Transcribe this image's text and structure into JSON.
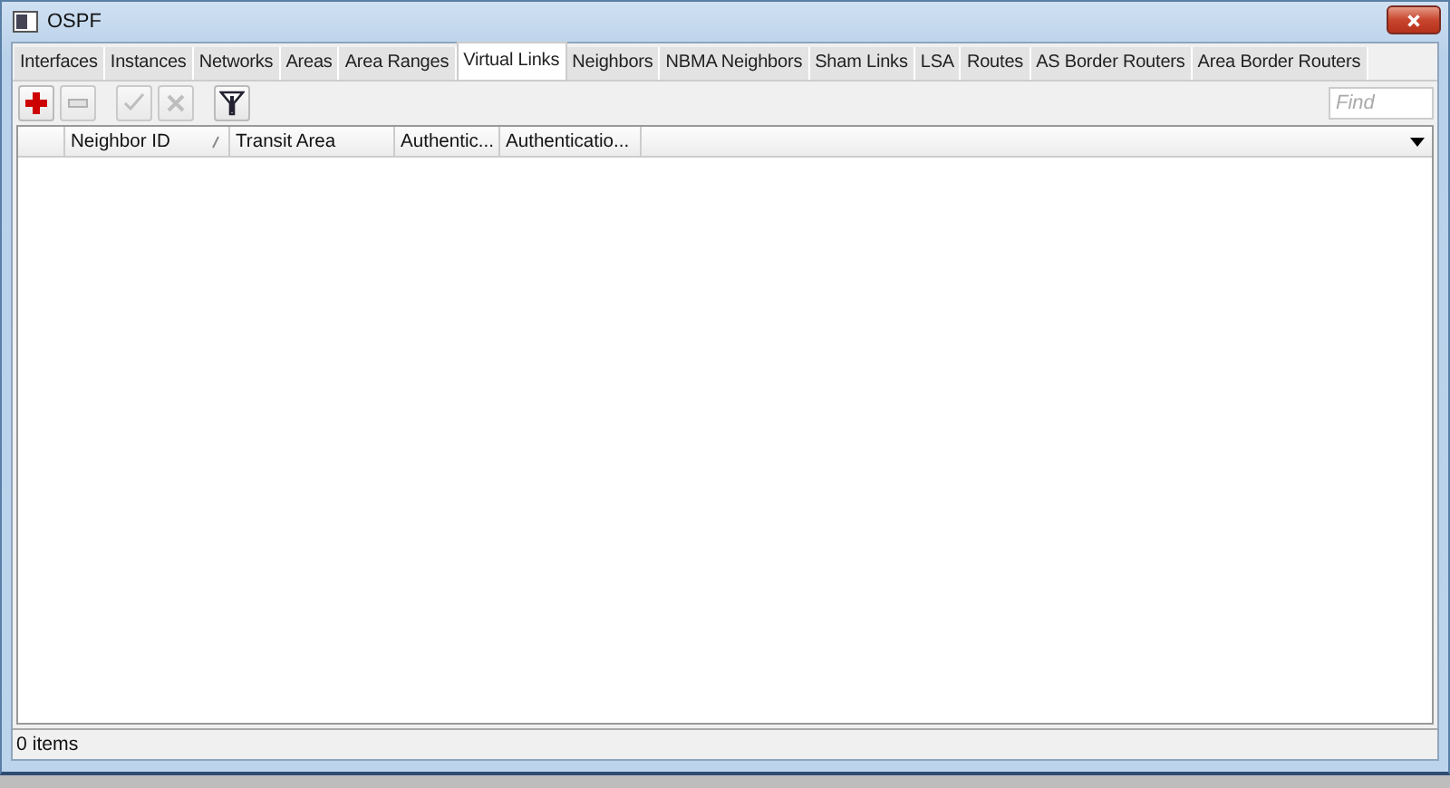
{
  "window": {
    "title": "OSPF"
  },
  "tabs": [
    {
      "label": "Interfaces",
      "selected": false
    },
    {
      "label": "Instances",
      "selected": false
    },
    {
      "label": "Networks",
      "selected": false
    },
    {
      "label": "Areas",
      "selected": false
    },
    {
      "label": "Area Ranges",
      "selected": false
    },
    {
      "label": "Virtual Links",
      "selected": true
    },
    {
      "label": "Neighbors",
      "selected": false
    },
    {
      "label": "NBMA Neighbors",
      "selected": false
    },
    {
      "label": "Sham Links",
      "selected": false
    },
    {
      "label": "LSA",
      "selected": false
    },
    {
      "label": "Routes",
      "selected": false
    },
    {
      "label": "AS Border Routers",
      "selected": false
    },
    {
      "label": "Area Border Routers",
      "selected": false
    }
  ],
  "toolbar": [
    {
      "kind": "add",
      "disabled": false
    },
    {
      "kind": "remove",
      "disabled": true
    },
    {
      "kind": "enable",
      "disabled": true
    },
    {
      "kind": "disable",
      "disabled": true
    },
    {
      "kind": "filter",
      "disabled": false
    }
  ],
  "search": {
    "placeholder": "Find"
  },
  "table": {
    "columns": [
      {
        "label": "Neighbor ID",
        "sorted": true
      },
      {
        "label": "Transit Area",
        "sorted": false
      },
      {
        "label": "Authentic...",
        "sorted": false
      },
      {
        "label": "Authenticatio...",
        "sorted": false
      }
    ]
  },
  "status_bar": "0 items"
}
